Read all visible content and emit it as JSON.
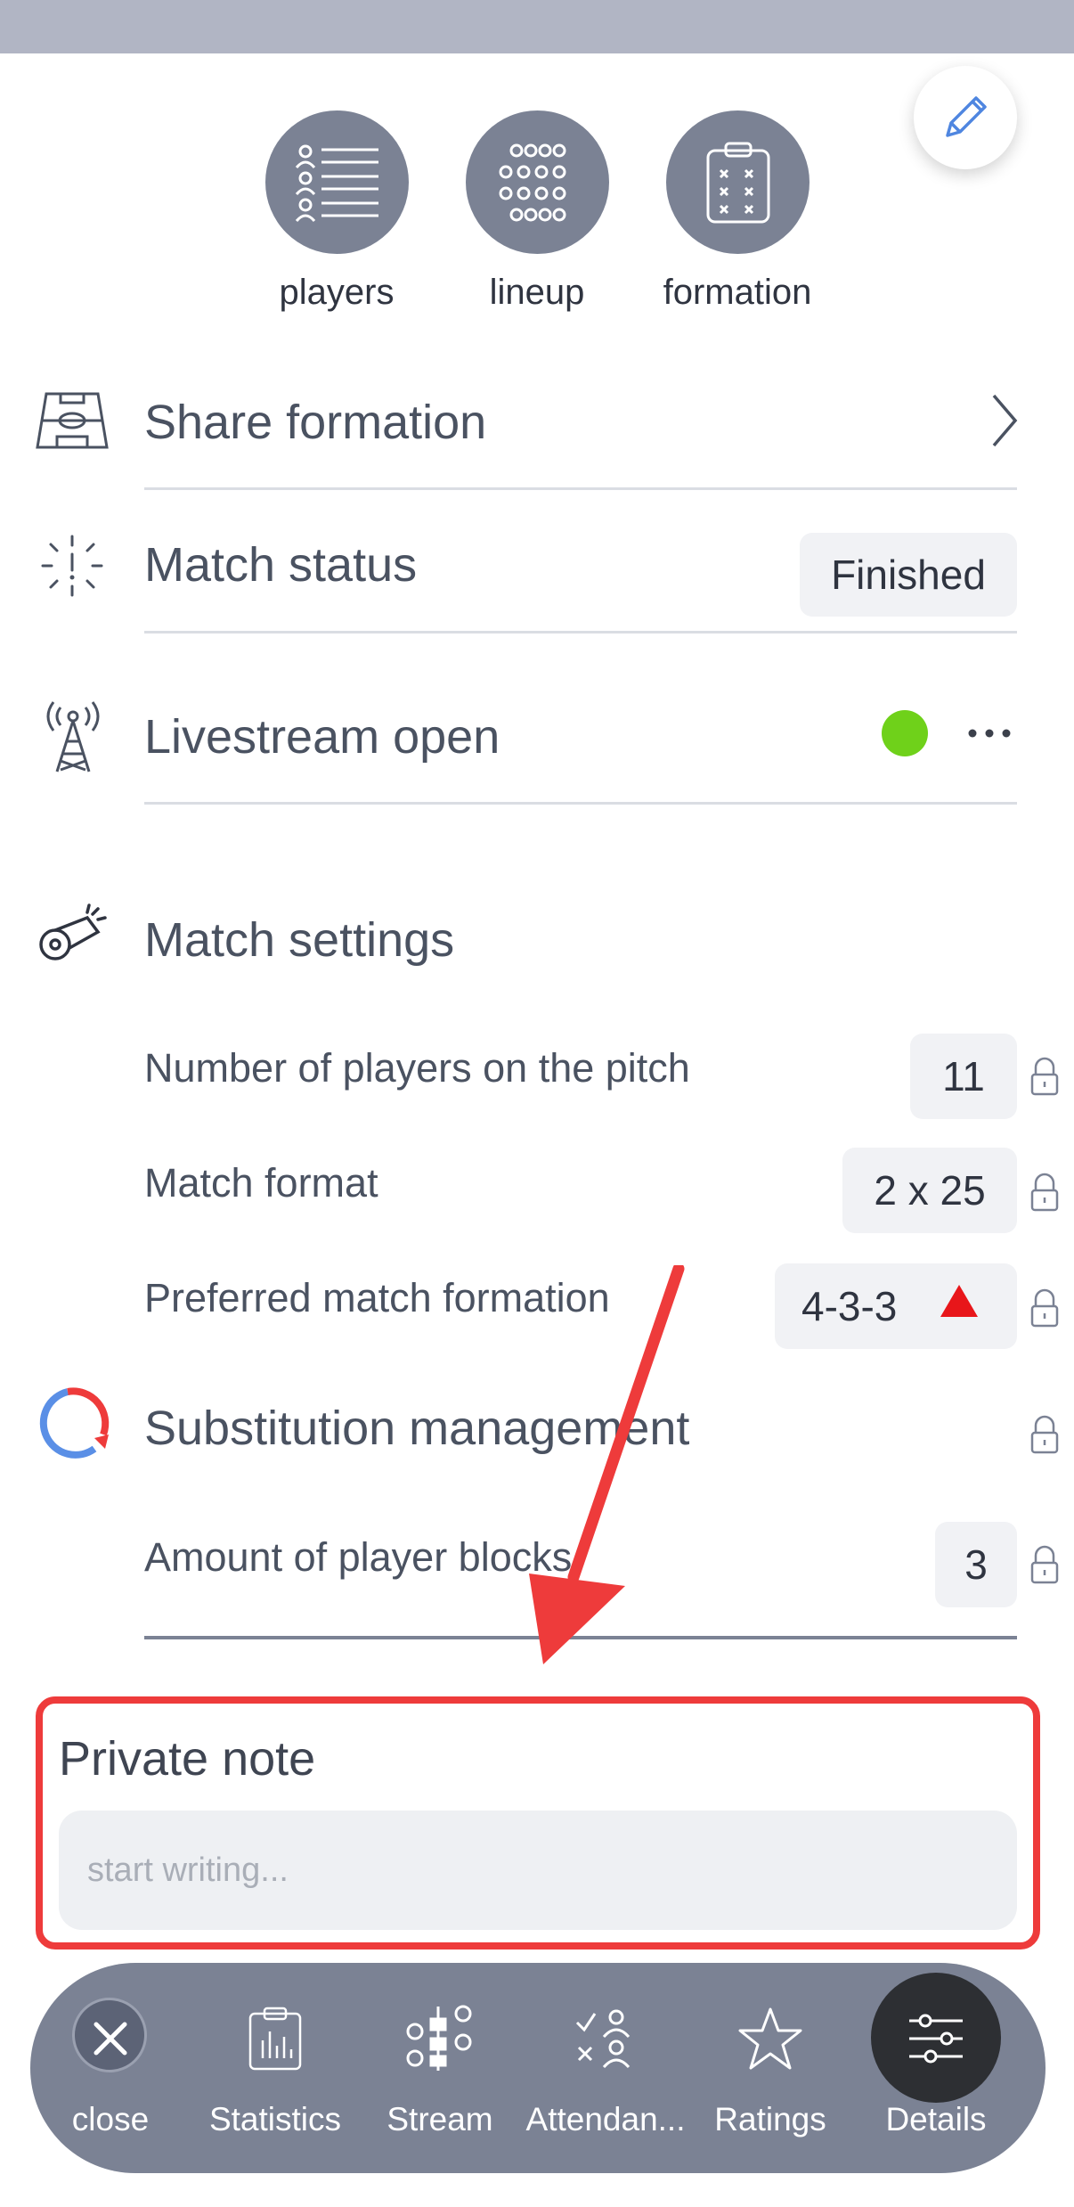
{
  "quick_actions": [
    {
      "label": "players",
      "icon": "players-list-icon"
    },
    {
      "label": "lineup",
      "icon": "lineup-grid-icon"
    },
    {
      "label": "formation",
      "icon": "formation-clipboard-icon"
    }
  ],
  "share_formation": {
    "label": "Share formation",
    "icon": "pitch-icon"
  },
  "match_status": {
    "label": "Match status",
    "value": "Finished",
    "icon": "status-burst-icon"
  },
  "livestream": {
    "label": "Livestream open",
    "status_color": "#6fd11a",
    "icon": "antenna-tower-icon"
  },
  "match_settings": {
    "title": "Match settings",
    "icon": "whistle-icon",
    "rows": [
      {
        "label": "Number of players on the pitch",
        "value": "11"
      },
      {
        "label": "Match format",
        "value": "2 x 25"
      },
      {
        "label": "Preferred match formation",
        "value": "4-3-3"
      }
    ]
  },
  "substitution": {
    "title": "Substitution management",
    "icon": "substitution-cycle-icon",
    "rows": [
      {
        "label": "Amount of player blocks",
        "value": "3"
      }
    ]
  },
  "private_note": {
    "title": "Private note",
    "placeholder": "start writing..."
  },
  "tabs": [
    {
      "label": "close",
      "icon": "close-icon"
    },
    {
      "label": "Statistics",
      "icon": "statistics-clipboard-icon"
    },
    {
      "label": "Stream",
      "icon": "stream-icon"
    },
    {
      "label": "Attendan...",
      "icon": "attendance-icon"
    },
    {
      "label": "Ratings",
      "icon": "star-icon"
    },
    {
      "label": "Details",
      "icon": "sliders-icon",
      "active": true
    }
  ],
  "colors": {
    "accent_red": "#ee3b3b",
    "status_green": "#6fd11a",
    "tab_bg": "#7b8294",
    "active_tab": "#2d2f33"
  }
}
